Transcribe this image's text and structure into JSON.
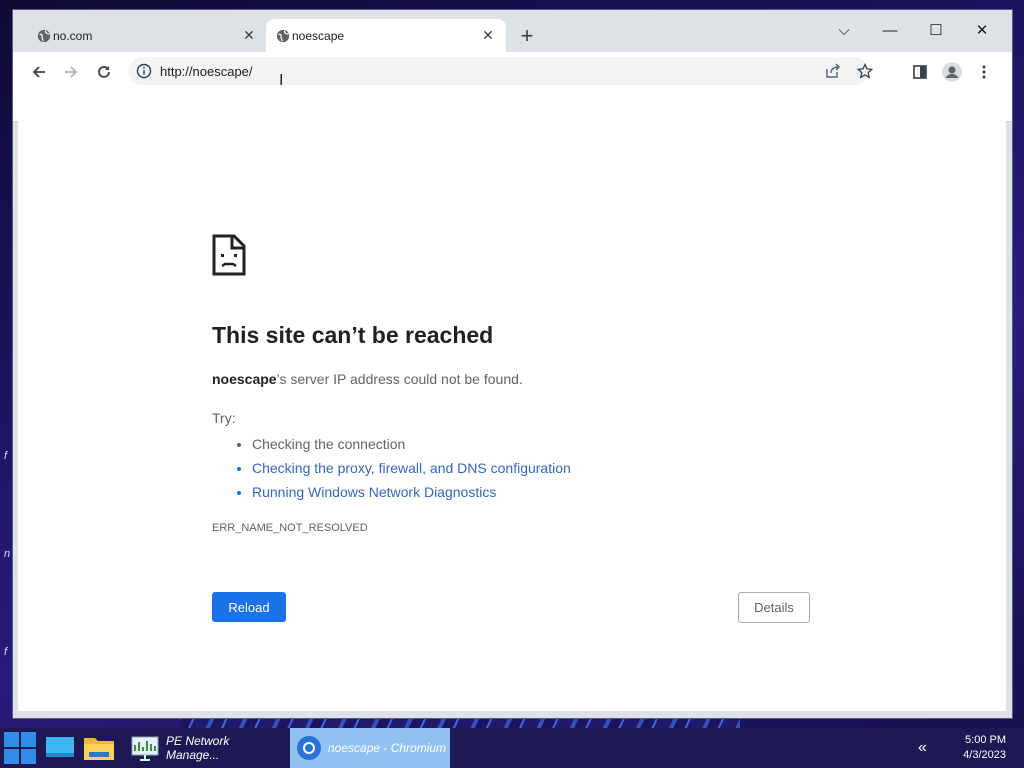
{
  "tabs": [
    {
      "title": "no.com",
      "close": "✕"
    },
    {
      "title": "noescape",
      "close": "✕"
    }
  ],
  "new_tab": "+",
  "window_controls": {
    "tab_search": "⌵",
    "minimize": "—",
    "maximize": "☐",
    "close": "✕"
  },
  "omnibox": {
    "url": "http://noescape/"
  },
  "error_page": {
    "title": "This site can’t be reached",
    "host": "noescape",
    "description_rest": "’s server IP address could not be found.",
    "try_label": "Try:",
    "suggestions": [
      "Checking the connection",
      "Checking the proxy, firewall, and DNS configuration",
      "Running Windows Network Diagnostics"
    ],
    "error_code": "ERR_NAME_NOT_RESOLVED",
    "reload_label": "Reload",
    "details_label": "Details"
  },
  "taskbar": {
    "apps": [
      {
        "label": "PE Network Manage..."
      },
      {
        "label": "noescape - Chromium"
      }
    ],
    "tray_chevron": "«",
    "time": "5:00 PM",
    "date": "4/3/2023"
  },
  "colors": {
    "accent": "#1a73e8",
    "link": "#3567b8",
    "taskbar": "#1e1855"
  }
}
